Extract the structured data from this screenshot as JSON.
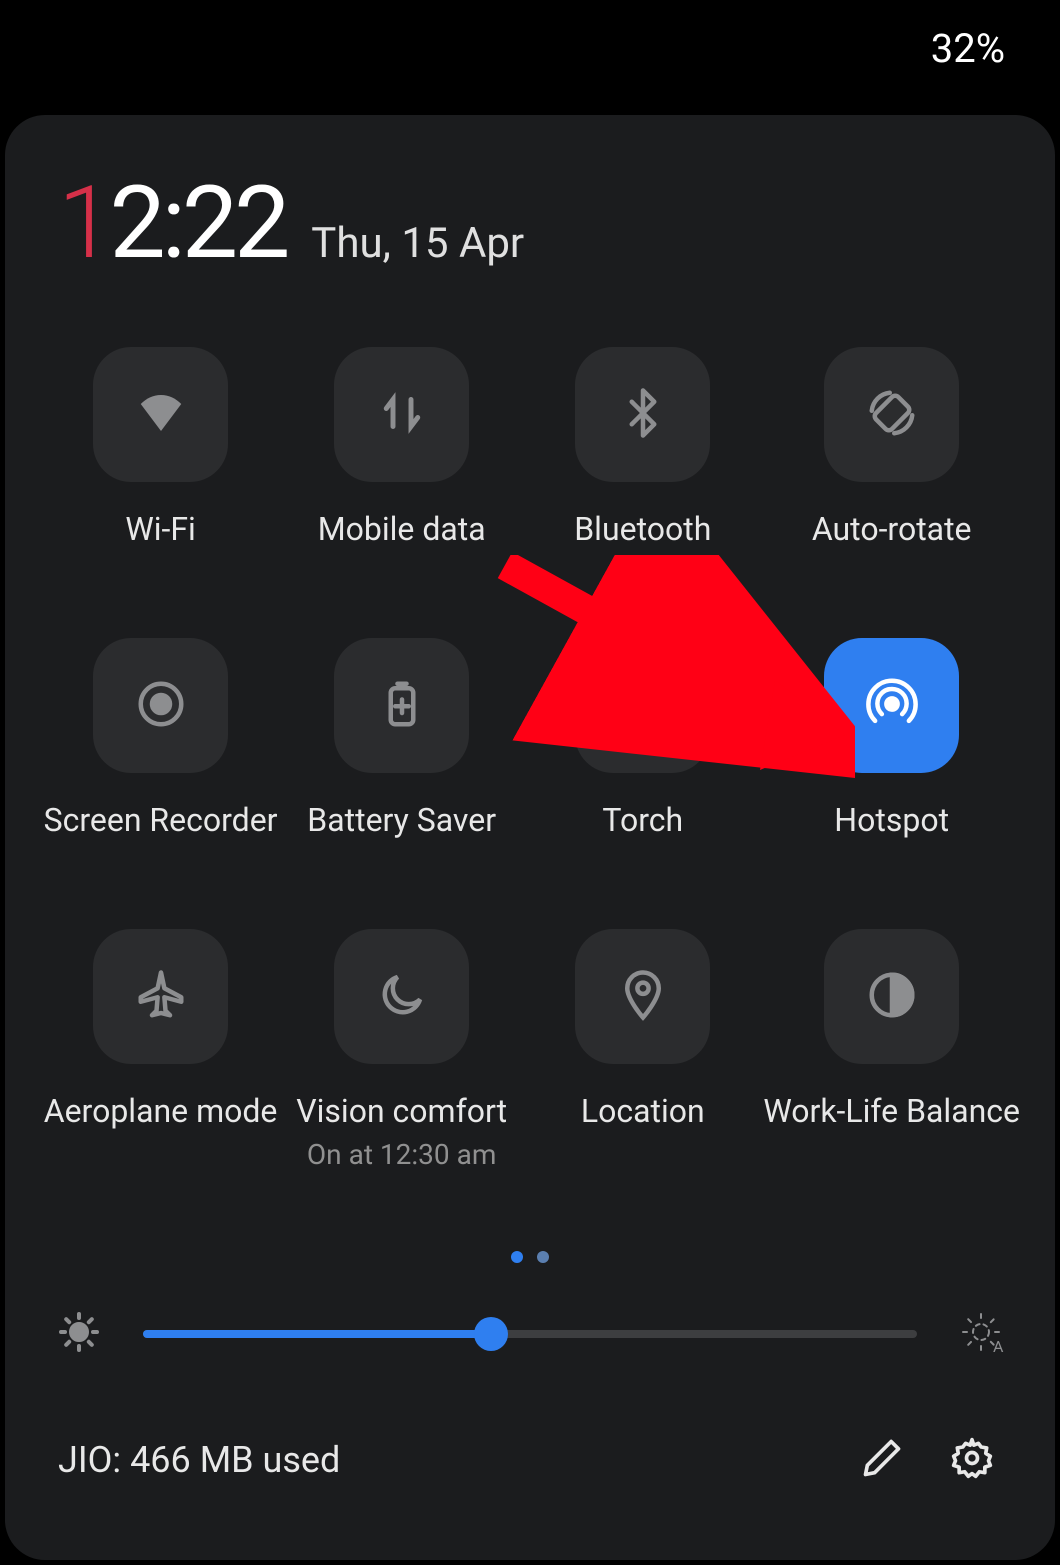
{
  "status": {
    "battery": "32%"
  },
  "clock": {
    "accent": "1",
    "rest": "2:22"
  },
  "date": "Thu, 15 Apr",
  "tiles": [
    {
      "label": "Wi-Fi",
      "active": false
    },
    {
      "label": "Mobile data",
      "active": false
    },
    {
      "label": "Bluetooth",
      "active": false
    },
    {
      "label": "Auto-rotate",
      "active": false
    },
    {
      "label": "Screen Recorder",
      "active": false
    },
    {
      "label": "Battery Saver",
      "active": false
    },
    {
      "label": "Torch",
      "active": false
    },
    {
      "label": "Hotspot",
      "active": true
    },
    {
      "label": "Aeroplane mode",
      "active": false
    },
    {
      "label": "Vision comfort",
      "sublabel": "On at 12:30 am",
      "active": false
    },
    {
      "label": "Location",
      "active": false
    },
    {
      "label": "Work-Life Balance",
      "active": false
    }
  ],
  "brightness": {
    "percent": 45
  },
  "footer": {
    "data_usage": "JIO: 466 MB used"
  },
  "colors": {
    "accent": "#2f7ff0",
    "clock_accent": "#d63049",
    "tile_bg": "#2b2c2e",
    "panel_bg": "#1b1c1e"
  }
}
